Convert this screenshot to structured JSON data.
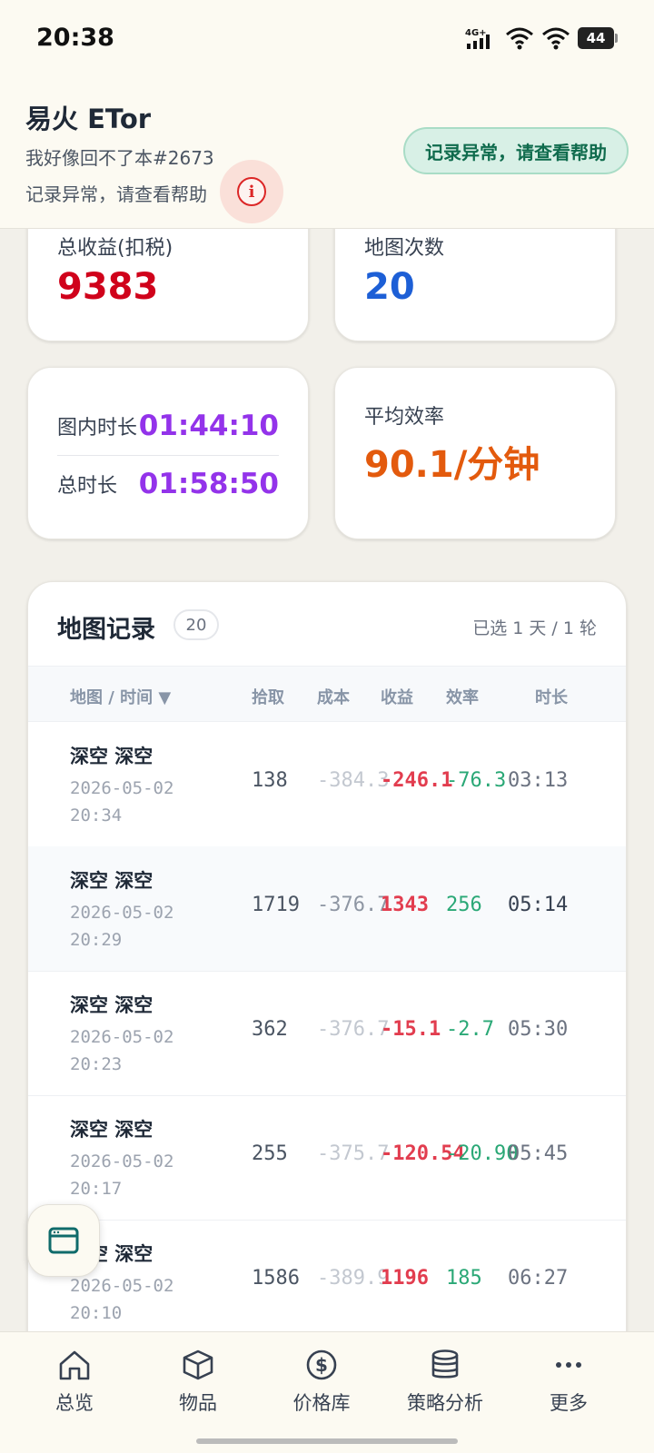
{
  "status_bar": {
    "time": "20:38",
    "network": "4G+",
    "battery": "44"
  },
  "header": {
    "title": "易火 ETor",
    "subtitle": "我好像回不了本#2673",
    "warning_text": "记录异常，请查看帮助",
    "warning_button": "记录异常，请查看帮助",
    "info_icon": "i"
  },
  "stats": {
    "total_profit": {
      "label": "总收益(扣税)",
      "value": "9383",
      "color": "#d0021b"
    },
    "map_count": {
      "label": "地图次数",
      "value": "20",
      "color": "#1d5fd6"
    },
    "map_time": {
      "label": "图内时长",
      "value": "01:44:10"
    },
    "total_time": {
      "label": "总时长",
      "value": "01:58:50"
    },
    "avg_efficiency": {
      "label": "平均效率",
      "value": "90.1/分钟",
      "color": "#e35a0d"
    }
  },
  "records": {
    "title": "地图记录",
    "count": "20",
    "selection": "已选 1 天 / 1 轮",
    "columns": {
      "map_time": "地图 / 时间 ▼",
      "pickup": "拾取",
      "cost": "成本",
      "profit": "收益",
      "efficiency": "效率",
      "duration": "时长"
    },
    "rows": [
      {
        "name": "深空 深空",
        "date": "2026-05-02",
        "time": "20:34",
        "pickup": "138",
        "cost": "-384.3",
        "profit": "-246.1",
        "efficiency": "-76.3",
        "duration": "03:13"
      },
      {
        "name": "深空 深空",
        "date": "2026-05-02",
        "time": "20:29",
        "pickup": "1719",
        "cost": "-376.7",
        "profit": "1343",
        "efficiency": "256",
        "duration": "05:14"
      },
      {
        "name": "深空 深空",
        "date": "2026-05-02",
        "time": "20:23",
        "pickup": "362",
        "cost": "-376.7",
        "profit": "-15.1",
        "efficiency": "-2.7",
        "duration": "05:30"
      },
      {
        "name": "深空 深空",
        "date": "2026-05-02",
        "time": "20:17",
        "pickup": "255",
        "cost": "-375.7",
        "profit": "-120.54",
        "efficiency": "-20.90",
        "duration": "05:45"
      },
      {
        "name": "深空 深空",
        "date": "2026-05-02",
        "time": "20:10",
        "pickup": "1586",
        "cost": "-389.9",
        "profit": "1196",
        "efficiency": "185",
        "duration": "06:27"
      }
    ]
  },
  "nav": [
    {
      "label": "总览",
      "icon": "home-icon"
    },
    {
      "label": "物品",
      "icon": "cube-icon"
    },
    {
      "label": "价格库",
      "icon": "dollar-icon"
    },
    {
      "label": "策略分析",
      "icon": "database-icon"
    },
    {
      "label": "更多",
      "icon": "more-icon"
    }
  ]
}
